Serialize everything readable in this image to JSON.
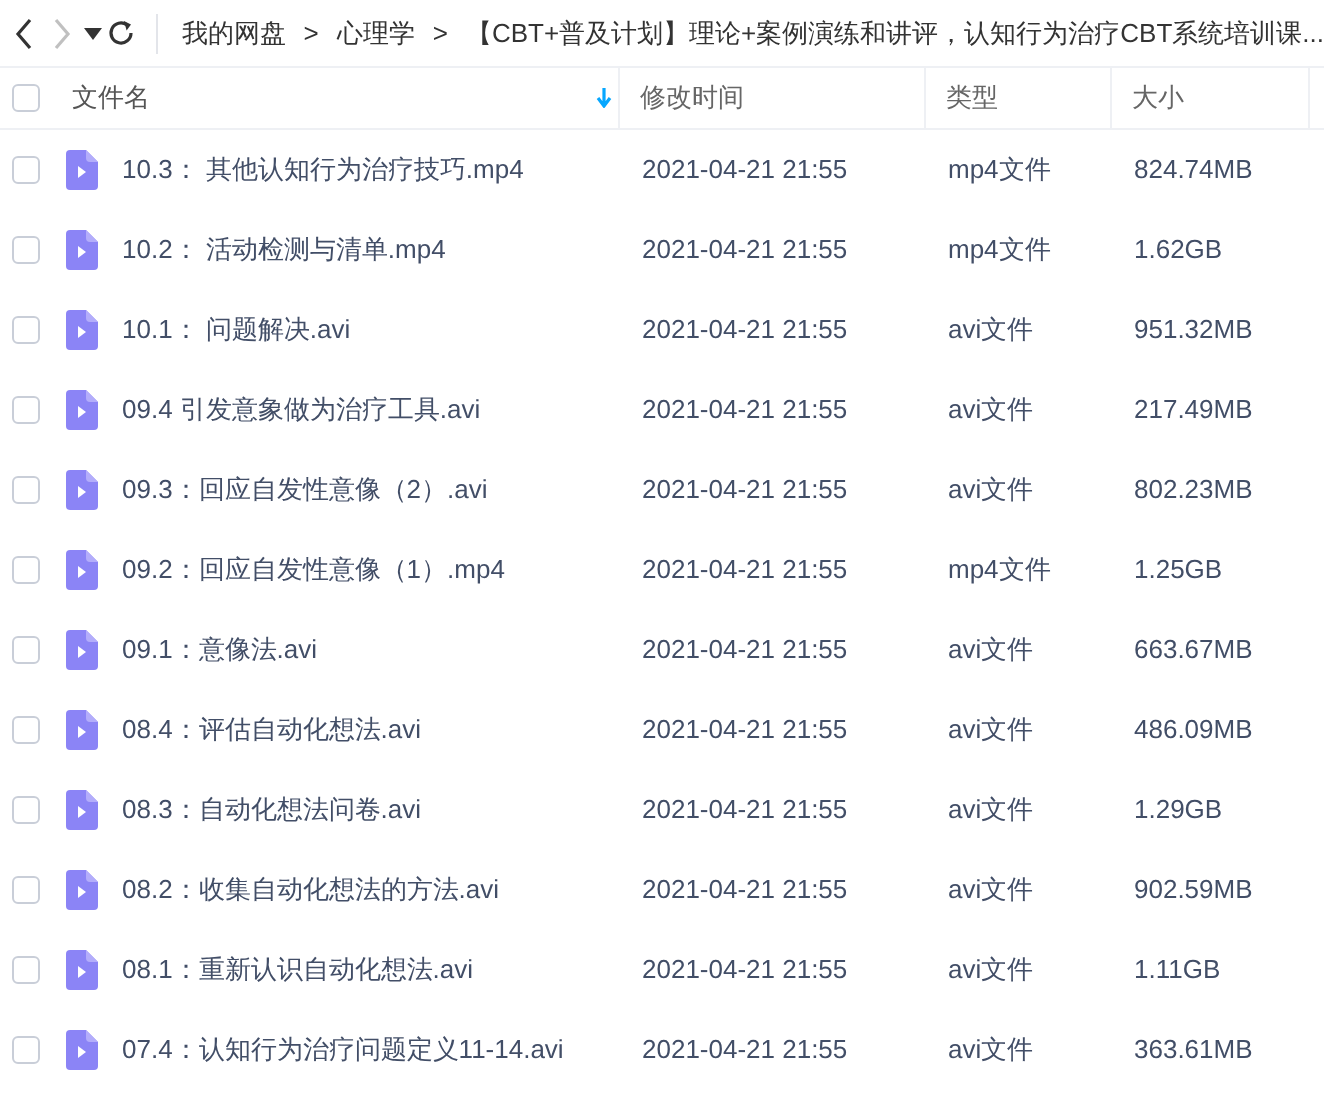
{
  "nav": {
    "back_disabled": false,
    "forward_disabled": true
  },
  "breadcrumb": [
    "我的网盘",
    "心理学",
    "【CBT+普及计划】理论+案例演练和讲评，认知行为治疗CBT系统培训课..."
  ],
  "breadcrumb_separator": ">",
  "table": {
    "columns": [
      {
        "label": "文件名",
        "sorted": true
      },
      {
        "label": "修改时间",
        "sorted": false
      },
      {
        "label": "类型",
        "sorted": false
      },
      {
        "label": "大小",
        "sorted": false
      }
    ],
    "select_all_checked": false,
    "rows": [
      {
        "name": "10.3： 其他认知行为治疗技巧.mp4",
        "modified": "2021-04-21 21:55",
        "type": "mp4文件",
        "size": "824.74MB",
        "checked": false
      },
      {
        "name": "10.2： 活动检测与清单.mp4",
        "modified": "2021-04-21 21:55",
        "type": "mp4文件",
        "size": "1.62GB",
        "checked": false
      },
      {
        "name": "10.1： 问题解决.avi",
        "modified": "2021-04-21 21:55",
        "type": "avi文件",
        "size": "951.32MB",
        "checked": false
      },
      {
        "name": "09.4 引发意象做为治疗工具.avi",
        "modified": "2021-04-21 21:55",
        "type": "avi文件",
        "size": "217.49MB",
        "checked": false
      },
      {
        "name": "09.3：回应自发性意像（2）.avi",
        "modified": "2021-04-21 21:55",
        "type": "avi文件",
        "size": "802.23MB",
        "checked": false
      },
      {
        "name": "09.2：回应自发性意像（1）.mp4",
        "modified": "2021-04-21 21:55",
        "type": "mp4文件",
        "size": "1.25GB",
        "checked": false
      },
      {
        "name": "09.1：意像法.avi",
        "modified": "2021-04-21 21:55",
        "type": "avi文件",
        "size": "663.67MB",
        "checked": false
      },
      {
        "name": "08.4：评估自动化想法.avi",
        "modified": "2021-04-21 21:55",
        "type": "avi文件",
        "size": "486.09MB",
        "checked": false
      },
      {
        "name": "08.3：自动化想法问卷.avi",
        "modified": "2021-04-21 21:55",
        "type": "avi文件",
        "size": "1.29GB",
        "checked": false
      },
      {
        "name": "08.2：收集自动化想法的方法.avi",
        "modified": "2021-04-21 21:55",
        "type": "avi文件",
        "size": "902.59MB",
        "checked": false
      },
      {
        "name": "08.1：重新认识自动化想法.avi",
        "modified": "2021-04-21 21:55",
        "type": "avi文件",
        "size": "1.11GB",
        "checked": false
      },
      {
        "name": "07.4：认知行为治疗问题定义11-14.avi",
        "modified": "2021-04-21 21:55",
        "type": "avi文件",
        "size": "363.61MB",
        "checked": false
      }
    ]
  }
}
